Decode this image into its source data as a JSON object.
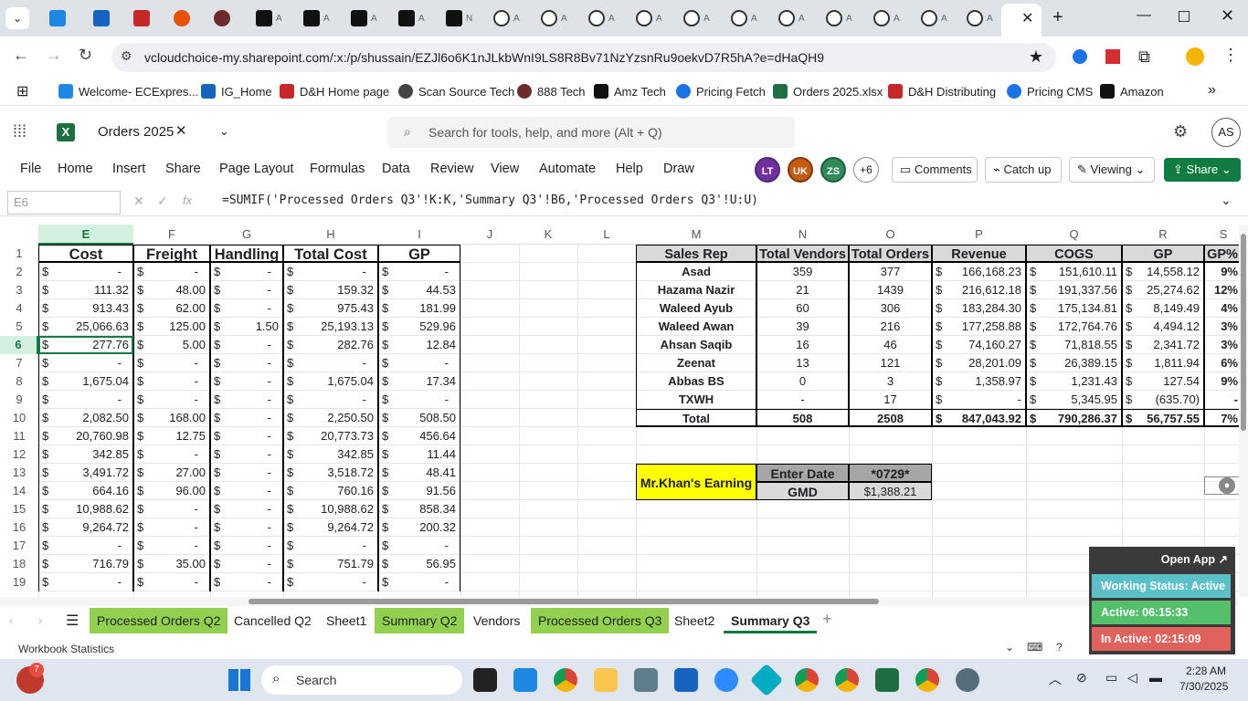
{
  "browser": {
    "url": "vcloudchoice-my.sharepoint.com/:x:/p/shussain/EZJl6o6K1nJLkbWnI9LS8R8Bv71NzYzsnRu9oekvD7R5hA?e=dHaQH9",
    "bookmarks": [
      "Welcome- ECExpres...",
      "IG_Home",
      "D&H Home page",
      "Scan Source Tech",
      "888 Tech",
      "Amz Tech",
      "Pricing Fetch",
      "Orders 2025.xlsx",
      "D&H Distributing",
      "Pricing CMS",
      "Amazon"
    ]
  },
  "excel": {
    "file_name": "Orders 2025",
    "search_placeholder": "Search for tools, help, and more (Alt + Q)",
    "user_initials": "AS",
    "menu": [
      "File",
      "Home",
      "Insert",
      "Share",
      "Page Layout",
      "Formulas",
      "Data",
      "Review",
      "View",
      "Automate",
      "Help",
      "Draw"
    ],
    "collaborators": [
      "LT",
      "UK",
      "ZS"
    ],
    "more_collaborators": "+6",
    "comments_label": "Comments",
    "catchup_label": "Catch up",
    "viewing_label": "Viewing",
    "share_label": "Share",
    "name_box": "E6",
    "formula": "=SUMIF('Processed Orders Q3'!K:K,'Summary Q3'!B6,'Processed Orders Q3'!U:U)"
  },
  "columns": [
    "E",
    "F",
    "G",
    "H",
    "I",
    "J",
    "K",
    "L",
    "M",
    "N",
    "O",
    "P",
    "Q",
    "R",
    "S"
  ],
  "rows": [
    "1",
    "2",
    "3",
    "4",
    "5",
    "6",
    "7",
    "8",
    "9",
    "10",
    "11",
    "12",
    "13",
    "14",
    "15",
    "16",
    "17",
    "18",
    "19"
  ],
  "left_table": {
    "headers": [
      "Cost",
      "Freight",
      "Handling",
      "Total Cost",
      "GP"
    ],
    "rows": [
      [
        "-",
        "-",
        "-",
        "-",
        "-"
      ],
      [
        "111.32",
        "48.00",
        "-",
        "159.32",
        "44.53"
      ],
      [
        "913.43",
        "62.00",
        "-",
        "975.43",
        "181.99"
      ],
      [
        "25,066.63",
        "125.00",
        "1.50",
        "25,193.13",
        "529.96"
      ],
      [
        "277.76",
        "5.00",
        "-",
        "282.76",
        "12.84"
      ],
      [
        "-",
        "-",
        "-",
        "-",
        "-"
      ],
      [
        "1,675.04",
        "-",
        "-",
        "1,675.04",
        "17.34"
      ],
      [
        "-",
        "-",
        "-",
        "-",
        "-"
      ],
      [
        "2,082.50",
        "168.00",
        "-",
        "2,250.50",
        "508.50"
      ],
      [
        "20,760.98",
        "12.75",
        "-",
        "20,773.73",
        "456.64"
      ],
      [
        "342.85",
        "-",
        "-",
        "342.85",
        "11.44"
      ],
      [
        "3,491.72",
        "27.00",
        "-",
        "3,518.72",
        "48.41"
      ],
      [
        "664.16",
        "96.00",
        "-",
        "760.16",
        "91.56"
      ],
      [
        "10,988.62",
        "-",
        "-",
        "10,988.62",
        "858.34"
      ],
      [
        "9,264.72",
        "-",
        "-",
        "9,264.72",
        "200.32"
      ],
      [
        "-",
        "-",
        "-",
        "-",
        "-"
      ],
      [
        "716.79",
        "35.00",
        "-",
        "751.79",
        "56.95"
      ],
      [
        "-",
        "-",
        "-",
        "-",
        "-"
      ]
    ]
  },
  "right_table": {
    "headers": [
      "Sales Rep",
      "Total Vendors",
      "Total Orders",
      "Revenue",
      "COGS",
      "GP",
      "GP%"
    ],
    "rows": [
      [
        "Asad",
        "359",
        "377",
        "166,168.23",
        "151,610.11",
        "14,558.12",
        "9%"
      ],
      [
        "Hazama Nazir",
        "21",
        "1439",
        "216,612.18",
        "191,337.56",
        "25,274.62",
        "12%"
      ],
      [
        "Waleed Ayub",
        "60",
        "306",
        "183,284.30",
        "175,134.81",
        "8,149.49",
        "4%"
      ],
      [
        "Waleed Awan",
        "39",
        "216",
        "177,258.88",
        "172,764.76",
        "4,494.12",
        "3%"
      ],
      [
        "Ahsan Saqib",
        "16",
        "46",
        "74,160.27",
        "71,818.55",
        "2,341.72",
        "3%"
      ],
      [
        "Zeenat",
        "13",
        "121",
        "28,201.09",
        "26,389.15",
        "1,811.94",
        "6%"
      ],
      [
        "Abbas BS",
        "0",
        "3",
        "1,358.97",
        "1,231.43",
        "127.54",
        "9%"
      ],
      [
        "TXWH",
        "-",
        "17",
        "-",
        "5,345.95",
        "(635.70)",
        "-"
      ]
    ],
    "total": [
      "Total",
      "508",
      "2508",
      "847,043.92",
      "790,286.37",
      "56,757.55",
      "7%"
    ]
  },
  "earning": {
    "label": "Mr.Khan's Earning",
    "enter_date_label": "Enter Date",
    "enter_date_value": "*0729*",
    "gmd_label": "GMD",
    "gmd_value": "$1,388.21"
  },
  "sheet_tabs": [
    "Processed Orders Q2",
    "Cancelled Q2",
    "Sheet1",
    "Summary Q2",
    "Vendors",
    "Processed Orders Q3",
    "Sheet2",
    "Summary Q3"
  ],
  "status": {
    "left": "Workbook Statistics"
  },
  "popup": {
    "open_app": "Open App",
    "working_status": "Working Status: Active",
    "active": "Active: 06:15:33",
    "inactive": "In Active: 02:15:09"
  },
  "taskbar": {
    "search_label": "Search",
    "badge": "7",
    "time": "2:28 AM",
    "date": "7/30/2025"
  }
}
